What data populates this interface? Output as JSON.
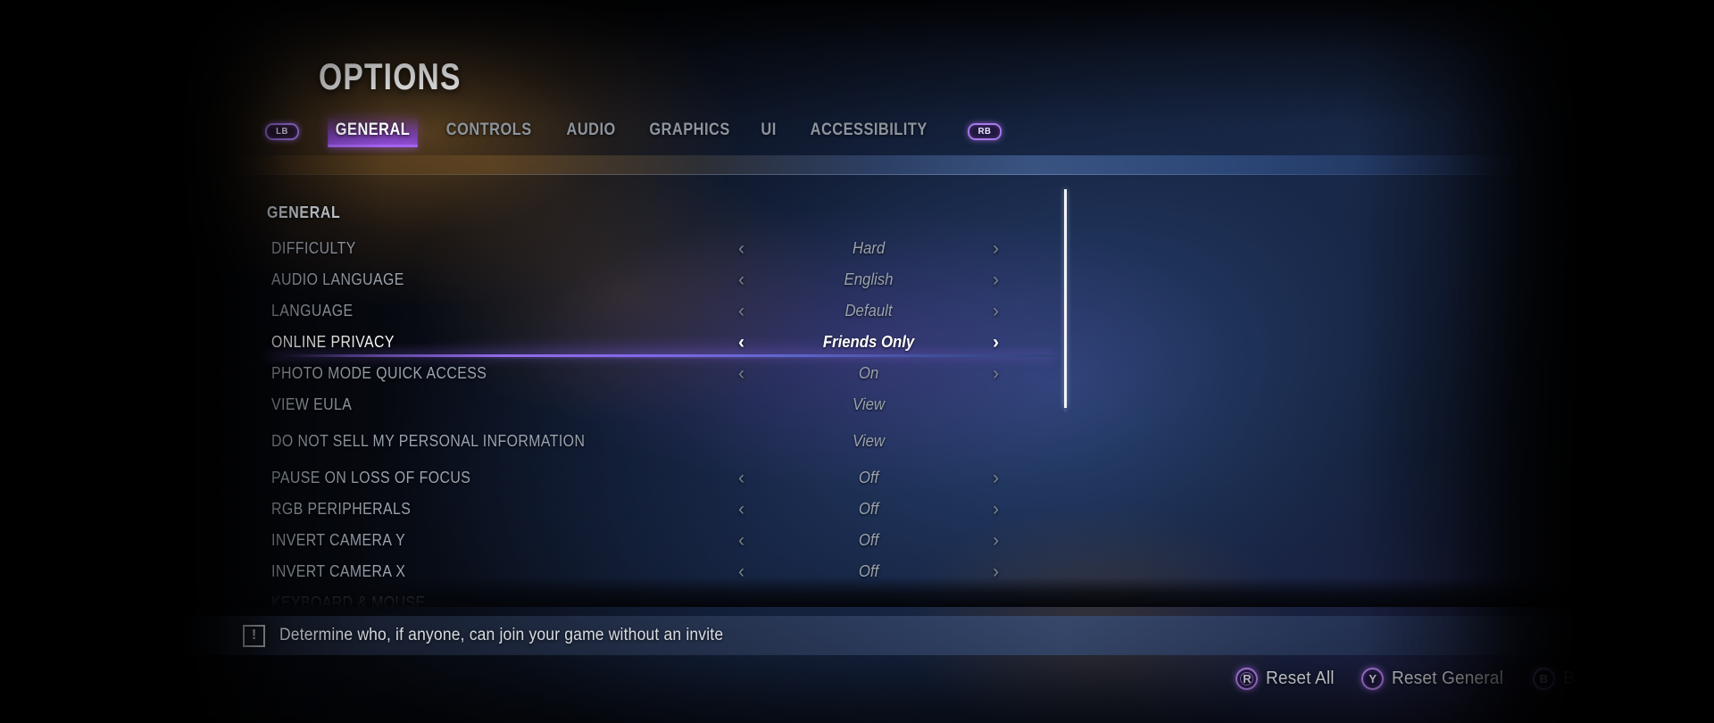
{
  "header": {
    "title": "OPTIONS",
    "left_bumper": "LB",
    "right_bumper": "RB",
    "tabs": [
      {
        "label": "GENERAL",
        "active": true
      },
      {
        "label": "CONTROLS",
        "active": false
      },
      {
        "label": "AUDIO",
        "active": false
      },
      {
        "label": "GRAPHICS",
        "active": false
      },
      {
        "label": "UI",
        "active": false
      },
      {
        "label": "ACCESSIBILITY",
        "active": false
      }
    ]
  },
  "list": {
    "section_title": "GENERAL",
    "arrow_left": "‹",
    "arrow_right": "›",
    "rows": [
      {
        "label": "DIFFICULTY",
        "value": "Hard",
        "arrows": true,
        "selected": false,
        "tall": false
      },
      {
        "label": "AUDIO LANGUAGE",
        "value": "English",
        "arrows": true,
        "selected": false,
        "tall": false
      },
      {
        "label": "LANGUAGE",
        "value": "Default",
        "arrows": true,
        "selected": false,
        "tall": false
      },
      {
        "label": "ONLINE PRIVACY",
        "value": "Friends Only",
        "arrows": true,
        "selected": true,
        "tall": false
      },
      {
        "label": "PHOTO MODE QUICK ACCESS",
        "value": "On",
        "arrows": true,
        "selected": false,
        "tall": false
      },
      {
        "label": "VIEW EULA",
        "value": "View",
        "arrows": false,
        "selected": false,
        "tall": false
      },
      {
        "label": "DO NOT SELL MY PERSONAL INFORMATION",
        "value": "View",
        "arrows": false,
        "selected": false,
        "tall": true
      },
      {
        "label": "PAUSE ON LOSS OF FOCUS",
        "value": "Off",
        "arrows": true,
        "selected": false,
        "tall": false
      },
      {
        "label": "RGB PERIPHERALS",
        "value": "Off",
        "arrows": true,
        "selected": false,
        "tall": false
      },
      {
        "label": "INVERT CAMERA Y",
        "value": "Off",
        "arrows": true,
        "selected": false,
        "tall": false
      },
      {
        "label": "INVERT CAMERA X",
        "value": "Off",
        "arrows": true,
        "selected": false,
        "tall": false
      },
      {
        "label": "KEYBOARD & MOUSE",
        "value": "",
        "arrows": false,
        "selected": false,
        "tall": false
      }
    ]
  },
  "help": {
    "icon": "!",
    "text": "Determine who, if anyone, can join your game without an invite"
  },
  "prompts": [
    {
      "button": "R",
      "label": "Reset All",
      "stick": true
    },
    {
      "button": "Y",
      "label": "Reset General",
      "stick": false
    },
    {
      "button": "B",
      "label": "Back",
      "stick": false
    }
  ],
  "colors": {
    "accent_purple": "#a463ee",
    "tab_active_bg": "#7e40c4",
    "selected_text": "#ffffff",
    "idle_text": "#9aa3ae"
  }
}
